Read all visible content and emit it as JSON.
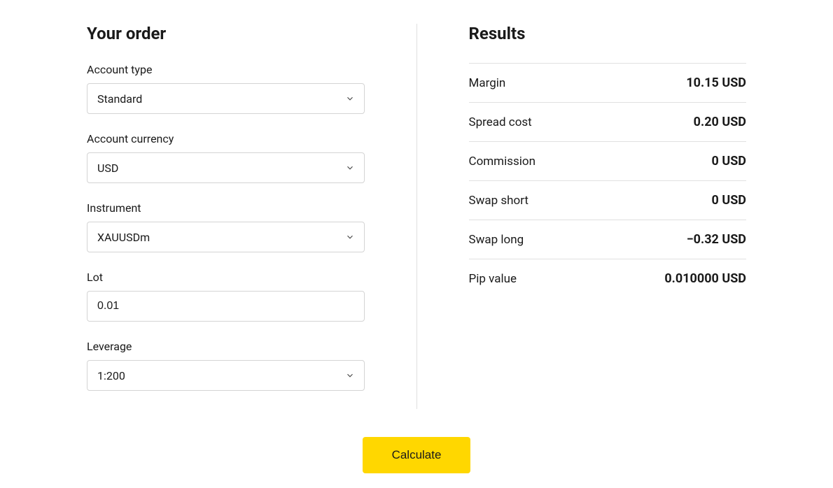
{
  "order": {
    "title": "Your order",
    "fields": {
      "account_type": {
        "label": "Account type",
        "value": "Standard"
      },
      "account_currency": {
        "label": "Account currency",
        "value": "USD"
      },
      "instrument": {
        "label": "Instrument",
        "value": "XAUUSDm"
      },
      "lot": {
        "label": "Lot",
        "value": "0.01"
      },
      "leverage": {
        "label": "Leverage",
        "value": "1:200"
      }
    }
  },
  "results": {
    "title": "Results",
    "rows": {
      "margin": {
        "label": "Margin",
        "value": "10.15 USD"
      },
      "spread_cost": {
        "label": "Spread cost",
        "value": "0.20 USD"
      },
      "commission": {
        "label": "Commission",
        "value": "0 USD"
      },
      "swap_short": {
        "label": "Swap short",
        "value": "0 USD"
      },
      "swap_long": {
        "label": "Swap long",
        "value": "−0.32 USD"
      },
      "pip_value": {
        "label": "Pip value",
        "value": "0.010000 USD"
      }
    }
  },
  "actions": {
    "calculate": "Calculate"
  }
}
